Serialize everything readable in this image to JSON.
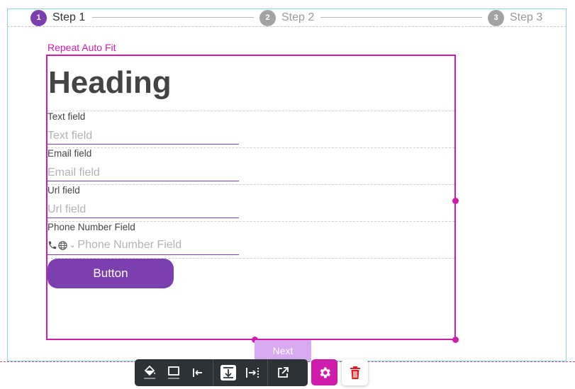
{
  "colors": {
    "accent": "#7b3fb0",
    "selection": "#d01cab",
    "inactive_step": "#a3a3a3",
    "next_button": "#d7a9ef",
    "toolbar_bg": "#2d3237",
    "delete_icon": "#e02020"
  },
  "stepper": {
    "steps": [
      {
        "number": "1",
        "label": "Step 1",
        "state": "active"
      },
      {
        "number": "2",
        "label": "Step 2",
        "state": "inactive"
      },
      {
        "number": "3",
        "label": "Step 3",
        "state": "inactive"
      }
    ]
  },
  "container": {
    "label": "Repeat Auto Fit"
  },
  "form": {
    "heading": "Heading",
    "fields": [
      {
        "label": "Text field",
        "placeholder": "Text field"
      },
      {
        "label": "Email field",
        "placeholder": "Email field"
      },
      {
        "label": "Url field",
        "placeholder": "Url field"
      },
      {
        "label": "Phone Number Field",
        "placeholder": "Phone Number Field"
      }
    ],
    "button_label": "Button"
  },
  "next_label": "Next",
  "toolbar": {
    "tools": [
      "paint-bucket-icon",
      "border-box-icon",
      "align-left-icon",
      "align-bottom-icon",
      "fit-width-icon",
      "open-external-icon"
    ],
    "settings_icon": "gear-icon",
    "delete_icon": "trash-icon"
  }
}
